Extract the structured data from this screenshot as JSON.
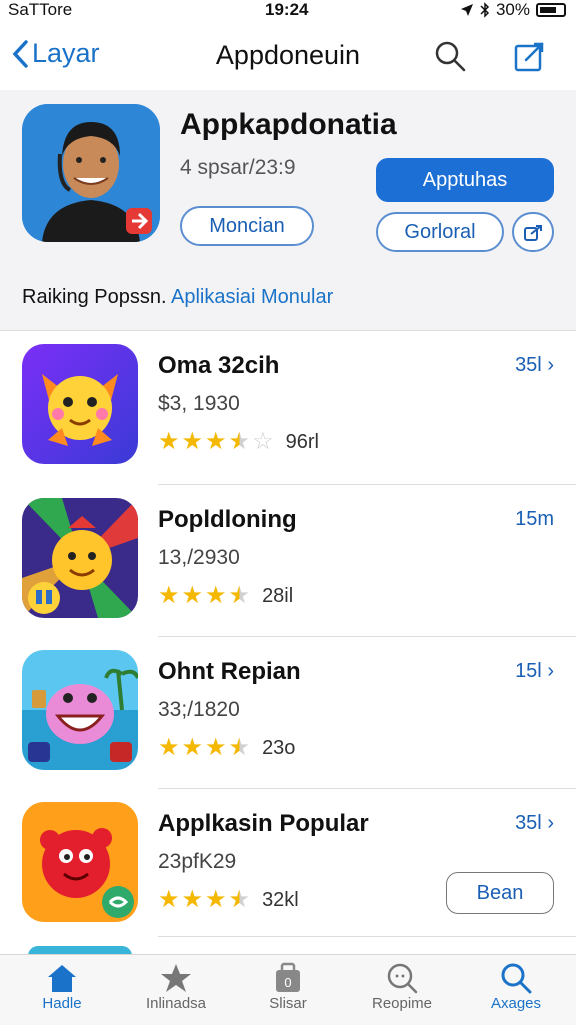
{
  "status_bar": {
    "carrier": "SaTTore",
    "time": "19:24",
    "battery": "30%"
  },
  "nav": {
    "back_label": "Layar",
    "title": "Appdoneuin"
  },
  "hero": {
    "app_name": "Appkapdonatia",
    "subtitle": "4 spsar/23:9",
    "primary_button": "Apptuhas",
    "secondary_button": "Moncian",
    "tertiary_button": "Gorloral",
    "caption": "Raiking Popssn.",
    "caption_link": "Aplikasiai Monular"
  },
  "apps": [
    {
      "name": "Oma 32cih",
      "subtitle": "$3, 1930",
      "rating": 3.5,
      "rating_count": "96rl",
      "size": "35l"
    },
    {
      "name": "Popldloning",
      "subtitle": "13,/2930",
      "rating": 3.5,
      "rating_count": "28il",
      "size": "15m"
    },
    {
      "name": "Ohnt Repian",
      "subtitle": "33;/1820",
      "rating": 3.5,
      "rating_count": "23o",
      "size": "15l"
    },
    {
      "name": "Applkasin Popular",
      "subtitle": "23pfK29",
      "rating": 3.5,
      "rating_count": "32kl",
      "size": "35l",
      "button": "Bean"
    }
  ],
  "tabs": [
    {
      "label": "Hadle",
      "icon": "home-icon",
      "active": true
    },
    {
      "label": "Inlinadsa",
      "icon": "star-icon",
      "active": false
    },
    {
      "label": "Slisar",
      "icon": "apps-icon",
      "active": false
    },
    {
      "label": "Reopime",
      "icon": "search-circle-icon",
      "active": false
    },
    {
      "label": "Axages",
      "icon": "search-icon",
      "active": true
    }
  ],
  "colors": {
    "accent": "#1c6fd4",
    "star": "#f5b800",
    "link": "#1a73c8"
  }
}
